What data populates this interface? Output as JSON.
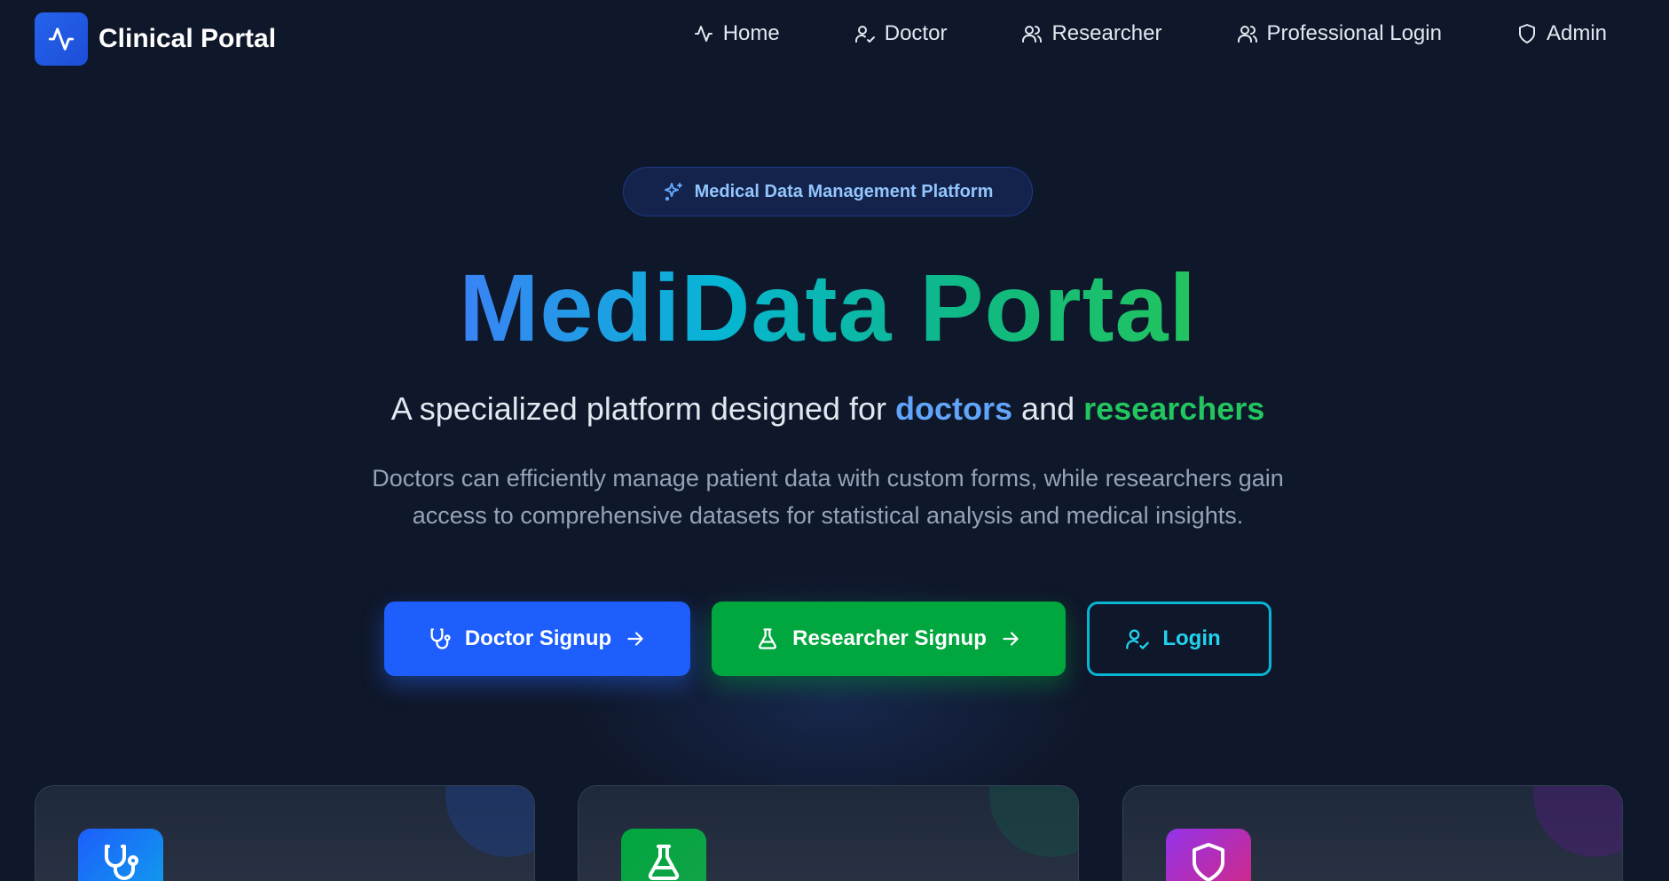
{
  "brand": {
    "title": "Clinical Portal",
    "logo_icon": "activity-pulse-icon"
  },
  "nav": {
    "items": [
      {
        "label": "Home",
        "icon": "activity-icon"
      },
      {
        "label": "Doctor",
        "icon": "user-check-icon"
      },
      {
        "label": "Researcher",
        "icon": "users-icon"
      },
      {
        "label": "Professional Login",
        "icon": "users-icon"
      },
      {
        "label": "Admin",
        "icon": "shield-icon"
      }
    ]
  },
  "hero": {
    "badge": "Medical Data Management Platform",
    "title": "MediData Portal",
    "subtitle_prefix": "A specialized platform designed for ",
    "subtitle_doctors": "doctors",
    "subtitle_and": " and ",
    "subtitle_researchers": "researchers",
    "description": "Doctors can efficiently manage patient data with custom forms, while researchers gain access to comprehensive datasets for statistical analysis and medical insights."
  },
  "buttons": {
    "doctor_signup": "Doctor Signup",
    "researcher_signup": "Researcher Signup",
    "login": "Login"
  },
  "cards": [
    {
      "icon": "stethoscope-icon",
      "color": "#1d6ff2"
    },
    {
      "icon": "flask-icon",
      "color": "#00a63e"
    },
    {
      "icon": "shield-icon",
      "color": "#a21caf"
    }
  ],
  "colors": {
    "background": "#0f172a",
    "accent_blue": "#1d5efc",
    "accent_green": "#00a63e",
    "accent_cyan": "#06b6d4"
  }
}
